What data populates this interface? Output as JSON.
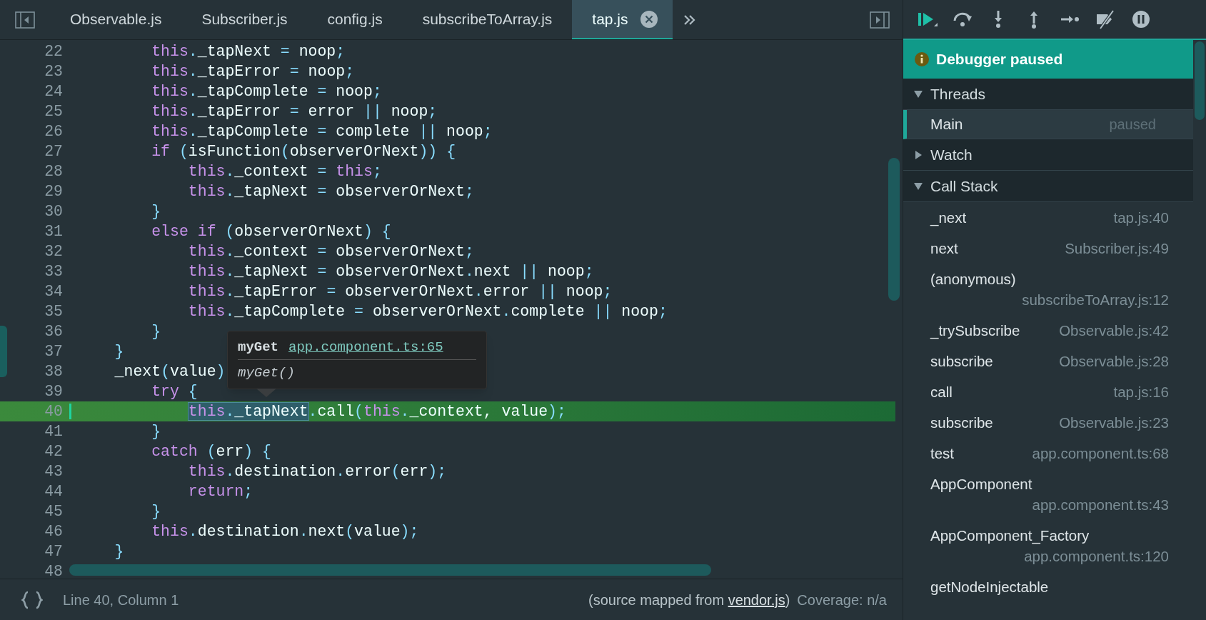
{
  "tabs": [
    {
      "label": "Observable.js",
      "selected": false
    },
    {
      "label": "Subscriber.js",
      "selected": false
    },
    {
      "label": "config.js",
      "selected": false
    },
    {
      "label": "subscribeToArray.js",
      "selected": false
    },
    {
      "label": "tap.js",
      "selected": true
    }
  ],
  "editor": {
    "lines": [
      {
        "number": "22",
        "current": false,
        "segments": [
          {
            "kind": "keyword",
            "text": "        this"
          },
          {
            "kind": "operator",
            "text": "."
          },
          {
            "kind": "plain",
            "text": "_tapNext "
          },
          {
            "kind": "operator",
            "text": "="
          },
          {
            "kind": "plain",
            "text": " noop"
          },
          {
            "kind": "operator",
            "text": ";"
          }
        ]
      },
      {
        "number": "23",
        "current": false,
        "segments": [
          {
            "kind": "keyword",
            "text": "        this"
          },
          {
            "kind": "operator",
            "text": "."
          },
          {
            "kind": "plain",
            "text": "_tapError "
          },
          {
            "kind": "operator",
            "text": "="
          },
          {
            "kind": "plain",
            "text": " noop"
          },
          {
            "kind": "operator",
            "text": ";"
          }
        ]
      },
      {
        "number": "24",
        "current": false,
        "segments": [
          {
            "kind": "keyword",
            "text": "        this"
          },
          {
            "kind": "operator",
            "text": "."
          },
          {
            "kind": "plain",
            "text": "_tapComplete "
          },
          {
            "kind": "operator",
            "text": "="
          },
          {
            "kind": "plain",
            "text": " noop"
          },
          {
            "kind": "operator",
            "text": ";"
          }
        ]
      },
      {
        "number": "25",
        "current": false,
        "segments": [
          {
            "kind": "keyword",
            "text": "        this"
          },
          {
            "kind": "operator",
            "text": "."
          },
          {
            "kind": "plain",
            "text": "_tapError "
          },
          {
            "kind": "operator",
            "text": "="
          },
          {
            "kind": "plain",
            "text": " error "
          },
          {
            "kind": "operator",
            "text": "||"
          },
          {
            "kind": "plain",
            "text": " noop"
          },
          {
            "kind": "operator",
            "text": ";"
          }
        ]
      },
      {
        "number": "26",
        "current": false,
        "segments": [
          {
            "kind": "keyword",
            "text": "        this"
          },
          {
            "kind": "operator",
            "text": "."
          },
          {
            "kind": "plain",
            "text": "_tapComplete "
          },
          {
            "kind": "operator",
            "text": "="
          },
          {
            "kind": "plain",
            "text": " complete "
          },
          {
            "kind": "operator",
            "text": "||"
          },
          {
            "kind": "plain",
            "text": " noop"
          },
          {
            "kind": "operator",
            "text": ";"
          }
        ]
      },
      {
        "number": "27",
        "current": false,
        "segments": [
          {
            "kind": "keyword",
            "text": "        if"
          },
          {
            "kind": "operator",
            "text": " ("
          },
          {
            "kind": "plain",
            "text": "isFunction"
          },
          {
            "kind": "operator",
            "text": "("
          },
          {
            "kind": "plain",
            "text": "observerOrNext"
          },
          {
            "kind": "operator",
            "text": ")) {"
          }
        ]
      },
      {
        "number": "28",
        "current": false,
        "segments": [
          {
            "kind": "keyword",
            "text": "            this"
          },
          {
            "kind": "operator",
            "text": "."
          },
          {
            "kind": "plain",
            "text": "_context "
          },
          {
            "kind": "operator",
            "text": "="
          },
          {
            "kind": "keyword",
            "text": " this"
          },
          {
            "kind": "operator",
            "text": ";"
          }
        ]
      },
      {
        "number": "29",
        "current": false,
        "segments": [
          {
            "kind": "keyword",
            "text": "            this"
          },
          {
            "kind": "operator",
            "text": "."
          },
          {
            "kind": "plain",
            "text": "_tapNext "
          },
          {
            "kind": "operator",
            "text": "="
          },
          {
            "kind": "plain",
            "text": " observerOrNext"
          },
          {
            "kind": "operator",
            "text": ";"
          }
        ]
      },
      {
        "number": "30",
        "current": false,
        "segments": [
          {
            "kind": "operator",
            "text": "        }"
          }
        ]
      },
      {
        "number": "31",
        "current": false,
        "segments": [
          {
            "kind": "keyword",
            "text": "        else if"
          },
          {
            "kind": "operator",
            "text": " ("
          },
          {
            "kind": "plain",
            "text": "observerOrNext"
          },
          {
            "kind": "operator",
            "text": ") {"
          }
        ]
      },
      {
        "number": "32",
        "current": false,
        "segments": [
          {
            "kind": "keyword",
            "text": "            this"
          },
          {
            "kind": "operator",
            "text": "."
          },
          {
            "kind": "plain",
            "text": "_context "
          },
          {
            "kind": "operator",
            "text": "="
          },
          {
            "kind": "plain",
            "text": " observerOrNext"
          },
          {
            "kind": "operator",
            "text": ";"
          }
        ]
      },
      {
        "number": "33",
        "current": false,
        "segments": [
          {
            "kind": "keyword",
            "text": "            this"
          },
          {
            "kind": "operator",
            "text": "."
          },
          {
            "kind": "plain",
            "text": "_tapNext "
          },
          {
            "kind": "operator",
            "text": "="
          },
          {
            "kind": "plain",
            "text": " observerOrNext"
          },
          {
            "kind": "operator",
            "text": "."
          },
          {
            "kind": "plain",
            "text": "next "
          },
          {
            "kind": "operator",
            "text": "||"
          },
          {
            "kind": "plain",
            "text": " noop"
          },
          {
            "kind": "operator",
            "text": ";"
          }
        ]
      },
      {
        "number": "34",
        "current": false,
        "segments": [
          {
            "kind": "keyword",
            "text": "            this"
          },
          {
            "kind": "operator",
            "text": "."
          },
          {
            "kind": "plain",
            "text": "_tapError "
          },
          {
            "kind": "operator",
            "text": "="
          },
          {
            "kind": "plain",
            "text": " observerOrNext"
          },
          {
            "kind": "operator",
            "text": "."
          },
          {
            "kind": "plain",
            "text": "error "
          },
          {
            "kind": "operator",
            "text": "||"
          },
          {
            "kind": "plain",
            "text": " noop"
          },
          {
            "kind": "operator",
            "text": ";"
          }
        ]
      },
      {
        "number": "35",
        "current": false,
        "segments": [
          {
            "kind": "keyword",
            "text": "            this"
          },
          {
            "kind": "operator",
            "text": "."
          },
          {
            "kind": "plain",
            "text": "_tapComplete "
          },
          {
            "kind": "operator",
            "text": "="
          },
          {
            "kind": "plain",
            "text": " observerOrNext"
          },
          {
            "kind": "operator",
            "text": "."
          },
          {
            "kind": "plain",
            "text": "complete "
          },
          {
            "kind": "operator",
            "text": "||"
          },
          {
            "kind": "plain",
            "text": " noop"
          },
          {
            "kind": "operator",
            "text": ";"
          }
        ]
      },
      {
        "number": "36",
        "current": false,
        "segments": [
          {
            "kind": "operator",
            "text": "        }"
          }
        ]
      },
      {
        "number": "37",
        "current": false,
        "segments": [
          {
            "kind": "operator",
            "text": "    }"
          }
        ]
      },
      {
        "number": "38",
        "current": false,
        "segments": [
          {
            "kind": "plain",
            "text": "    _next"
          },
          {
            "kind": "operator",
            "text": "("
          },
          {
            "kind": "plain",
            "text": "value"
          },
          {
            "kind": "operator",
            "text": ")"
          }
        ]
      },
      {
        "number": "39",
        "current": false,
        "segments": [
          {
            "kind": "keyword",
            "text": "        try"
          },
          {
            "kind": "operator",
            "text": " {"
          }
        ]
      },
      {
        "number": "40",
        "current": true,
        "segments": [
          {
            "kind": "selection",
            "parts": [
              {
                "kind": "keyword",
                "text": "            this"
              },
              {
                "kind": "operator",
                "text": "."
              },
              {
                "kind": "plain",
                "text": "_tapNext"
              }
            ]
          },
          {
            "kind": "operator",
            "text": "."
          },
          {
            "kind": "plain",
            "text": "call"
          },
          {
            "kind": "operator",
            "text": "("
          },
          {
            "kind": "keyword",
            "text": "this"
          },
          {
            "kind": "operator",
            "text": "."
          },
          {
            "kind": "plain",
            "text": "_context, value"
          },
          {
            "kind": "operator",
            "text": ");"
          }
        ]
      },
      {
        "number": "41",
        "current": false,
        "segments": [
          {
            "kind": "operator",
            "text": "        }"
          }
        ]
      },
      {
        "number": "42",
        "current": false,
        "segments": [
          {
            "kind": "keyword",
            "text": "        catch"
          },
          {
            "kind": "operator",
            "text": " ("
          },
          {
            "kind": "plain",
            "text": "err"
          },
          {
            "kind": "operator",
            "text": ") {"
          }
        ]
      },
      {
        "number": "43",
        "current": false,
        "segments": [
          {
            "kind": "keyword",
            "text": "            this"
          },
          {
            "kind": "operator",
            "text": "."
          },
          {
            "kind": "plain",
            "text": "destination"
          },
          {
            "kind": "operator",
            "text": "."
          },
          {
            "kind": "plain",
            "text": "error"
          },
          {
            "kind": "operator",
            "text": "("
          },
          {
            "kind": "plain",
            "text": "err"
          },
          {
            "kind": "operator",
            "text": ");"
          }
        ]
      },
      {
        "number": "44",
        "current": false,
        "segments": [
          {
            "kind": "keyword",
            "text": "            return"
          },
          {
            "kind": "operator",
            "text": ";"
          }
        ]
      },
      {
        "number": "45",
        "current": false,
        "segments": [
          {
            "kind": "operator",
            "text": "        }"
          }
        ]
      },
      {
        "number": "46",
        "current": false,
        "segments": [
          {
            "kind": "keyword",
            "text": "        this"
          },
          {
            "kind": "operator",
            "text": "."
          },
          {
            "kind": "plain",
            "text": "destination"
          },
          {
            "kind": "operator",
            "text": "."
          },
          {
            "kind": "plain",
            "text": "next"
          },
          {
            "kind": "operator",
            "text": "("
          },
          {
            "kind": "plain",
            "text": "value"
          },
          {
            "kind": "operator",
            "text": ");"
          }
        ]
      },
      {
        "number": "47",
        "current": false,
        "segments": [
          {
            "kind": "operator",
            "text": "    }"
          }
        ]
      },
      {
        "number": "48",
        "current": false
      }
    ],
    "tooltip": {
      "name": "myGet",
      "location": "app.component.ts:65",
      "signature": "myGet()"
    }
  },
  "status_bar": {
    "position": "Line 40, Column 1",
    "source_prefix": "(source mapped from ",
    "source_link": "vendor.js",
    "source_suffix": ")",
    "coverage": "Coverage: n/a"
  },
  "sidebar": {
    "banner": "Debugger paused",
    "sections": [
      {
        "kind": "threads",
        "title": "Threads",
        "expanded": true,
        "items": [
          {
            "name": "Main",
            "status": "paused",
            "selected": true
          }
        ]
      },
      {
        "kind": "watch",
        "title": "Watch",
        "expanded": false
      },
      {
        "kind": "call_stack",
        "title": "Call Stack",
        "expanded": true,
        "frames": [
          {
            "name": "_next",
            "location": "tap.js:40"
          },
          {
            "name": "next",
            "location": "Subscriber.js:49"
          },
          {
            "name": "(anonymous)",
            "location": "subscribeToArray.js:12"
          },
          {
            "name": "_trySubscribe",
            "location": "Observable.js:42"
          },
          {
            "name": "subscribe",
            "location": "Observable.js:28"
          },
          {
            "name": "call",
            "location": "tap.js:16"
          },
          {
            "name": "subscribe",
            "location": "Observable.js:23"
          },
          {
            "name": "test",
            "location": "app.component.ts:68"
          },
          {
            "name": "AppComponent",
            "location": "app.component.ts:43"
          },
          {
            "name": "AppComponent_Factory",
            "location": "app.component.ts:120"
          },
          {
            "name": "getNodeInjectable"
          }
        ]
      }
    ]
  }
}
